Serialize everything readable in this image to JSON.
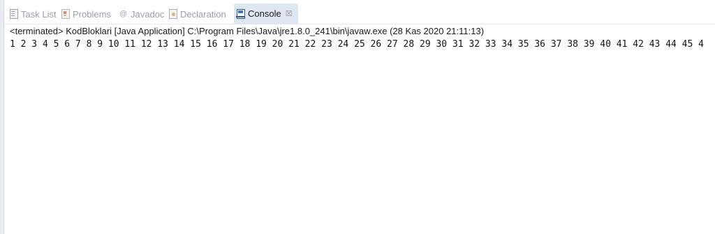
{
  "tabs": [
    {
      "label": "Task List",
      "icon": "task-list-icon"
    },
    {
      "label": "Problems",
      "icon": "problems-icon"
    },
    {
      "label": "Javadoc",
      "icon": "javadoc-icon"
    },
    {
      "label": "Declaration",
      "icon": "declaration-icon"
    },
    {
      "label": "Console",
      "icon": "console-icon",
      "active": true,
      "close_glyph": "☒"
    }
  ],
  "console": {
    "status": "<terminated> KodBloklari [Java Application] C:\\Program Files\\Java\\jre1.8.0_241\\bin\\javaw.exe (28 Kas 2020 21:11:13)",
    "output": "1 2 3 4 5 6 7 8 9 10 11 12 13 14 15 16 17 18 19 20 21 22 23 24 25 26 27 28 29 30 31 32 33 34 35 36 37 38 39 40 41 42 43 44 45 4"
  }
}
